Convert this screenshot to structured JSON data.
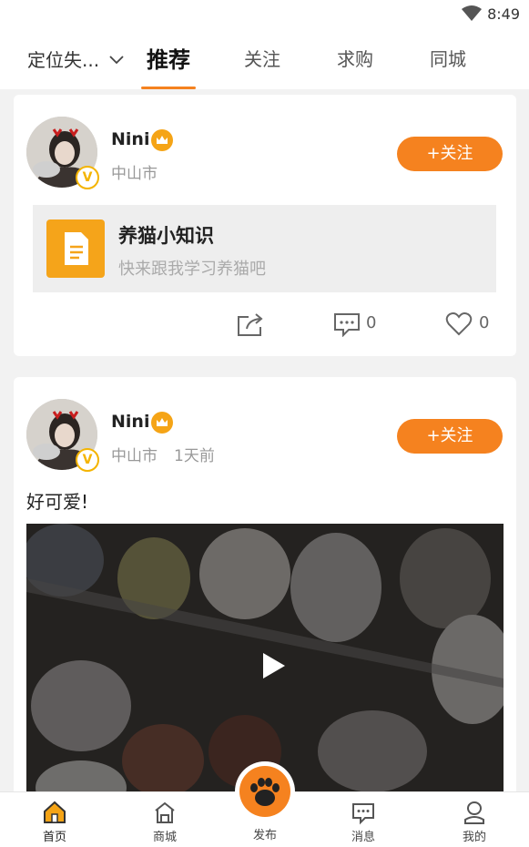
{
  "status": {
    "time": "8:49"
  },
  "topnav": {
    "location": "定位失...",
    "tabs": [
      {
        "label": "推荐",
        "active": true
      },
      {
        "label": "关注"
      },
      {
        "label": "求购"
      },
      {
        "label": "同城"
      }
    ]
  },
  "posts": [
    {
      "user": "Nini",
      "city": "中山市",
      "follow": "+关注",
      "article": {
        "title": "养猫小知识",
        "subtitle": "快来跟我学习养猫吧"
      },
      "comments": "0",
      "likes": "0"
    },
    {
      "user": "Nini",
      "city": "中山市",
      "time": "1天前",
      "follow": "+关注",
      "text": "好可爱!"
    }
  ],
  "tabbar": {
    "items": [
      {
        "label": "首页",
        "icon": "home-icon",
        "active": true
      },
      {
        "label": "商城",
        "icon": "shop-icon"
      },
      {
        "label": "发布",
        "icon": "paw-icon"
      },
      {
        "label": "消息",
        "icon": "message-icon"
      },
      {
        "label": "我的",
        "icon": "profile-icon"
      }
    ]
  },
  "colors": {
    "accent": "#f5821f",
    "gold": "#f5a416",
    "vip": "#f4b400"
  }
}
